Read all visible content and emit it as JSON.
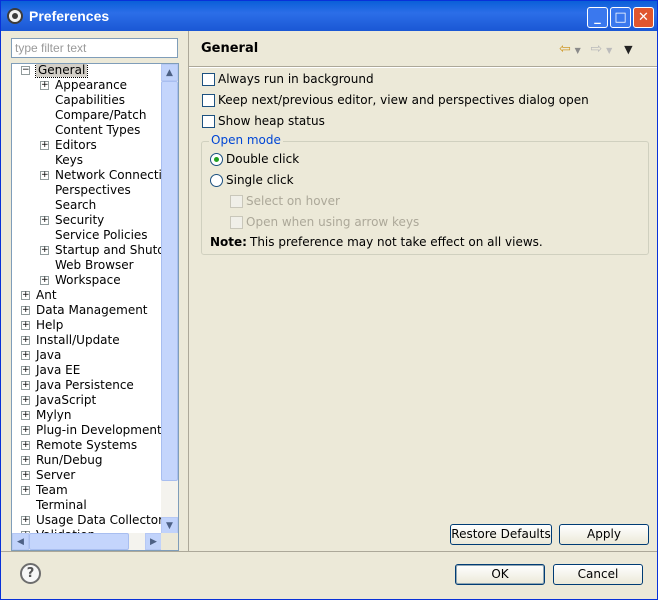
{
  "window": {
    "title": "Preferences"
  },
  "filter": {
    "placeholder": "type filter text"
  },
  "tree": {
    "general": "General",
    "general_children": [
      "Appearance",
      "Capabilities",
      "Compare/Patch",
      "Content Types",
      "Editors",
      "Keys",
      "Network Connectio",
      "Perspectives",
      "Search",
      "Security",
      "Service Policies",
      "Startup and Shutdo",
      "Web Browser",
      "Workspace"
    ],
    "general_children_expandable": [
      true,
      false,
      false,
      false,
      true,
      false,
      true,
      false,
      false,
      true,
      false,
      true,
      false,
      true
    ],
    "top_level": [
      "Ant",
      "Data Management",
      "Help",
      "Install/Update",
      "Java",
      "Java EE",
      "Java Persistence",
      "JavaScript",
      "Mylyn",
      "Plug-in Development",
      "Remote Systems",
      "Run/Debug",
      "Server",
      "Team",
      "Terminal",
      "Usage Data Collector",
      "Validation"
    ],
    "top_level_expandable": [
      true,
      true,
      true,
      true,
      true,
      true,
      true,
      true,
      true,
      true,
      true,
      true,
      true,
      true,
      false,
      true,
      true
    ]
  },
  "page": {
    "title": "General",
    "always_run_bg": "Always run in background",
    "keep_next_prev": "Keep next/previous editor, view and perspectives dialog open",
    "show_heap": "Show heap status",
    "open_mode_title": "Open mode",
    "double_click": "Double click",
    "single_click": "Single click",
    "select_on_hover": "Select on hover",
    "open_arrow_keys": "Open when using arrow keys",
    "note_label": "Note:",
    "note_text": "This preference may not take effect on all views."
  },
  "buttons": {
    "restore_defaults": "Restore Defaults",
    "apply": "Apply",
    "ok": "OK",
    "cancel": "Cancel"
  },
  "icons": [
    "eclipse-icon",
    "minimize-icon",
    "maximize-icon",
    "close-icon",
    "back-arrow-icon",
    "forward-arrow-icon",
    "view-menu-icon",
    "help-icon",
    "expand-icon",
    "collapse-icon"
  ]
}
